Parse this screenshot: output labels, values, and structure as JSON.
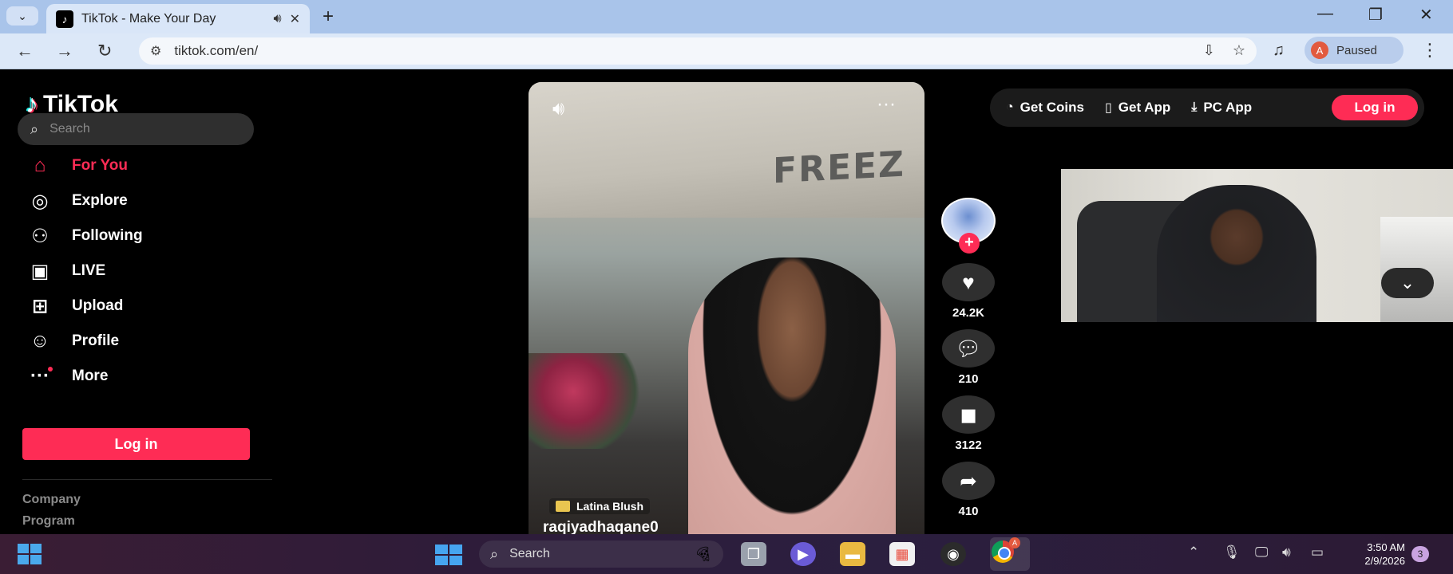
{
  "browser": {
    "tab_title": "TikTok - Make Your Day",
    "url": "tiktok.com/en/",
    "profile_status": "Paused",
    "profile_initial": "A"
  },
  "sidebar": {
    "logo": "TikTok",
    "search_placeholder": "Search",
    "items": [
      {
        "label": "For You",
        "icon": "home-icon"
      },
      {
        "label": "Explore",
        "icon": "compass-icon"
      },
      {
        "label": "Following",
        "icon": "following-icon"
      },
      {
        "label": "LIVE",
        "icon": "live-icon"
      },
      {
        "label": "Upload",
        "icon": "upload-icon"
      },
      {
        "label": "Profile",
        "icon": "person-icon"
      },
      {
        "label": "More",
        "icon": "more-icon"
      }
    ],
    "login_label": "Log in",
    "footer": [
      "Company",
      "Program"
    ]
  },
  "header_right": {
    "get_coins": "Get Coins",
    "get_app": "Get App",
    "pc_app": "PC App",
    "login": "Log in"
  },
  "video": {
    "brand_text": "FREEZ",
    "sound": "Latina Blush",
    "username": "raqiyadhaqane0"
  },
  "actions": {
    "likes": "24.2K",
    "comments": "210",
    "saves": "3122",
    "shares": "410"
  },
  "taskbar": {
    "search_label": "Search",
    "time": "3:50 AM",
    "date": "2/9/2026",
    "notifications": "3",
    "chrome_badge": "A"
  },
  "colors": {
    "accent": "#fe2c55",
    "background": "#000000"
  }
}
